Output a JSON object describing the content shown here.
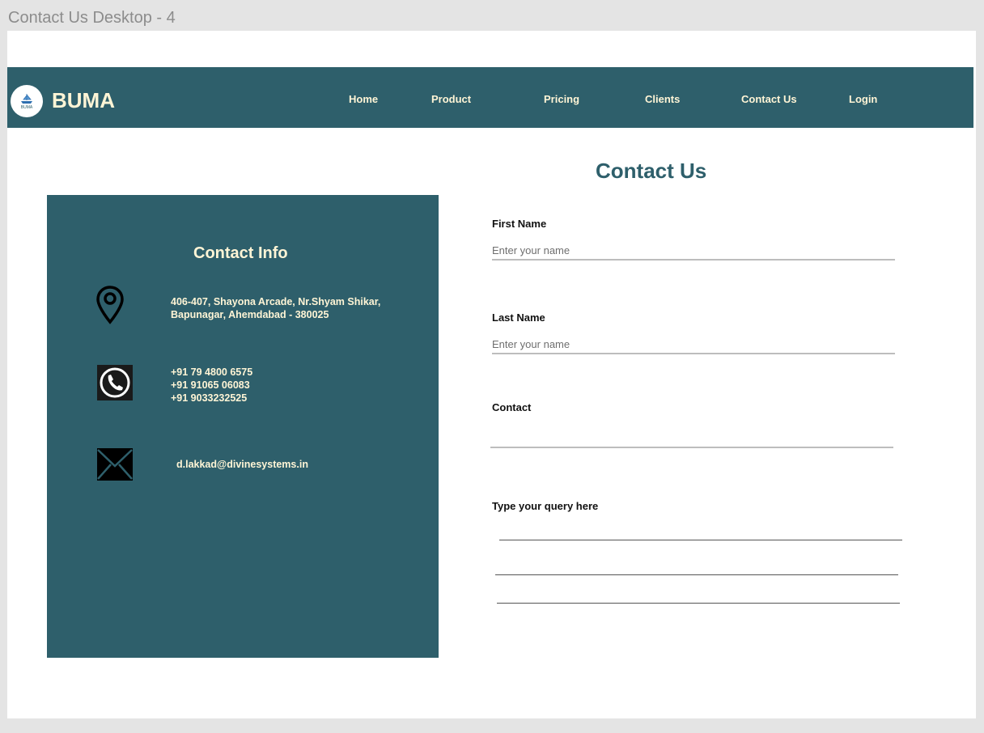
{
  "frame": {
    "title": "Contact Us Desktop - 4"
  },
  "header": {
    "logo_icon": "ship-logo-icon",
    "logo_caption": "BUMA",
    "brand": "BUMA",
    "nav": [
      {
        "label": "Home"
      },
      {
        "label": "Product"
      },
      {
        "label": "Pricing"
      },
      {
        "label": "Clients"
      },
      {
        "label": "Contact Us"
      },
      {
        "label": "Login"
      }
    ]
  },
  "main": {
    "heading": "Contact Us"
  },
  "contact_info": {
    "title": "Contact Info",
    "address_line1": "406-407, Shayona Arcade, Nr.Shyam Shikar,",
    "address_line2": "Bapunagar, Ahemdabad - 380025",
    "phones": [
      "+91 79 4800 6575",
      "+91 91065 06083",
      "+91 9033232525"
    ],
    "email": "d.lakkad@divinesystems.in",
    "icons": {
      "address": "location-pin-icon",
      "phone": "phone-icon",
      "email": "mail-icon"
    }
  },
  "form": {
    "first_name": {
      "label": "First Name",
      "placeholder": "Enter your name",
      "value": ""
    },
    "last_name": {
      "label": "Last Name",
      "placeholder": "Enter your name",
      "value": ""
    },
    "contact": {
      "label": "Contact",
      "placeholder": "",
      "value": ""
    },
    "query": {
      "label": "Type your query here"
    }
  },
  "colors": {
    "brand_teal": "#2e5f6b",
    "cream_text": "#fff5d6",
    "canvas_bg": "#ffffff",
    "outer_bg": "#e4e4e4"
  }
}
